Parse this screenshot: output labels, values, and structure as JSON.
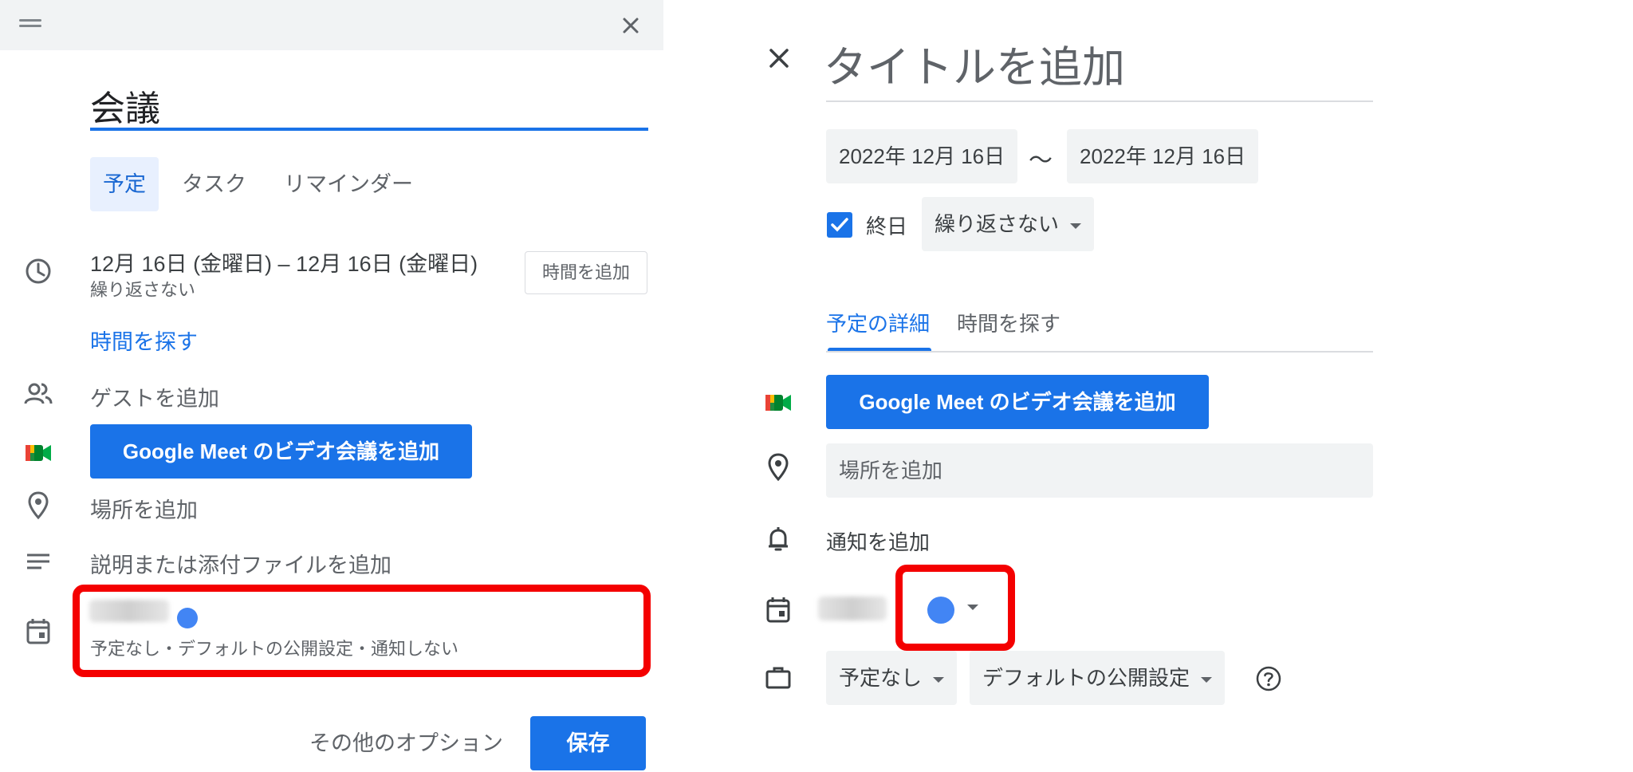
{
  "left_dialog": {
    "title_value": "会議",
    "type_tabs": [
      {
        "label": "予定",
        "active": true
      },
      {
        "label": "タスク",
        "active": false
      },
      {
        "label": "リマインダー",
        "active": false
      }
    ],
    "date_range": "12月 16日 (金曜日)  –  12月 16日 (金曜日)",
    "repeat": "繰り返さない",
    "add_time_button": "時間を追加",
    "find_time_link": "時間を探す",
    "add_guests": "ゲストを追加",
    "meet_button": "Google Meet のビデオ会議を追加",
    "add_location": "場所を追加",
    "add_description": "説明または添付ファイルを追加",
    "calendar_summary": "予定なし・デフォルトの公開設定・通知しない",
    "more_options": "その他のオプション",
    "save_button": "保存"
  },
  "right_page": {
    "title_placeholder": "タイトルを追加",
    "start_date": "2022年 12月 16日",
    "range_separator": "〜",
    "end_date": "2022年 12月 16日",
    "all_day_label": "終日",
    "all_day_checked": true,
    "repeat_select": "繰り返さない",
    "tabs": [
      {
        "label": "予定の詳細",
        "active": true
      },
      {
        "label": "時間を探す",
        "active": false
      }
    ],
    "meet_button": "Google Meet のビデオ会議を追加",
    "location_placeholder": "場所を追加",
    "add_notification": "通知を追加",
    "busy_select": "予定なし",
    "visibility_select": "デフォルトの公開設定"
  },
  "colors": {
    "accent_blue": "#1a73e8",
    "calendar_dot": "#4285f4",
    "highlight_red": "#f40000",
    "header_gray": "#f1f3f4"
  },
  "icons": [
    "drag-handle-icon",
    "close-icon",
    "clock-icon",
    "people-icon",
    "google-meet-icon",
    "location-pin-icon",
    "notes-icon",
    "calendar-icon",
    "bell-icon",
    "briefcase-icon",
    "help-icon",
    "chevron-down-icon",
    "checkmark-icon"
  ]
}
